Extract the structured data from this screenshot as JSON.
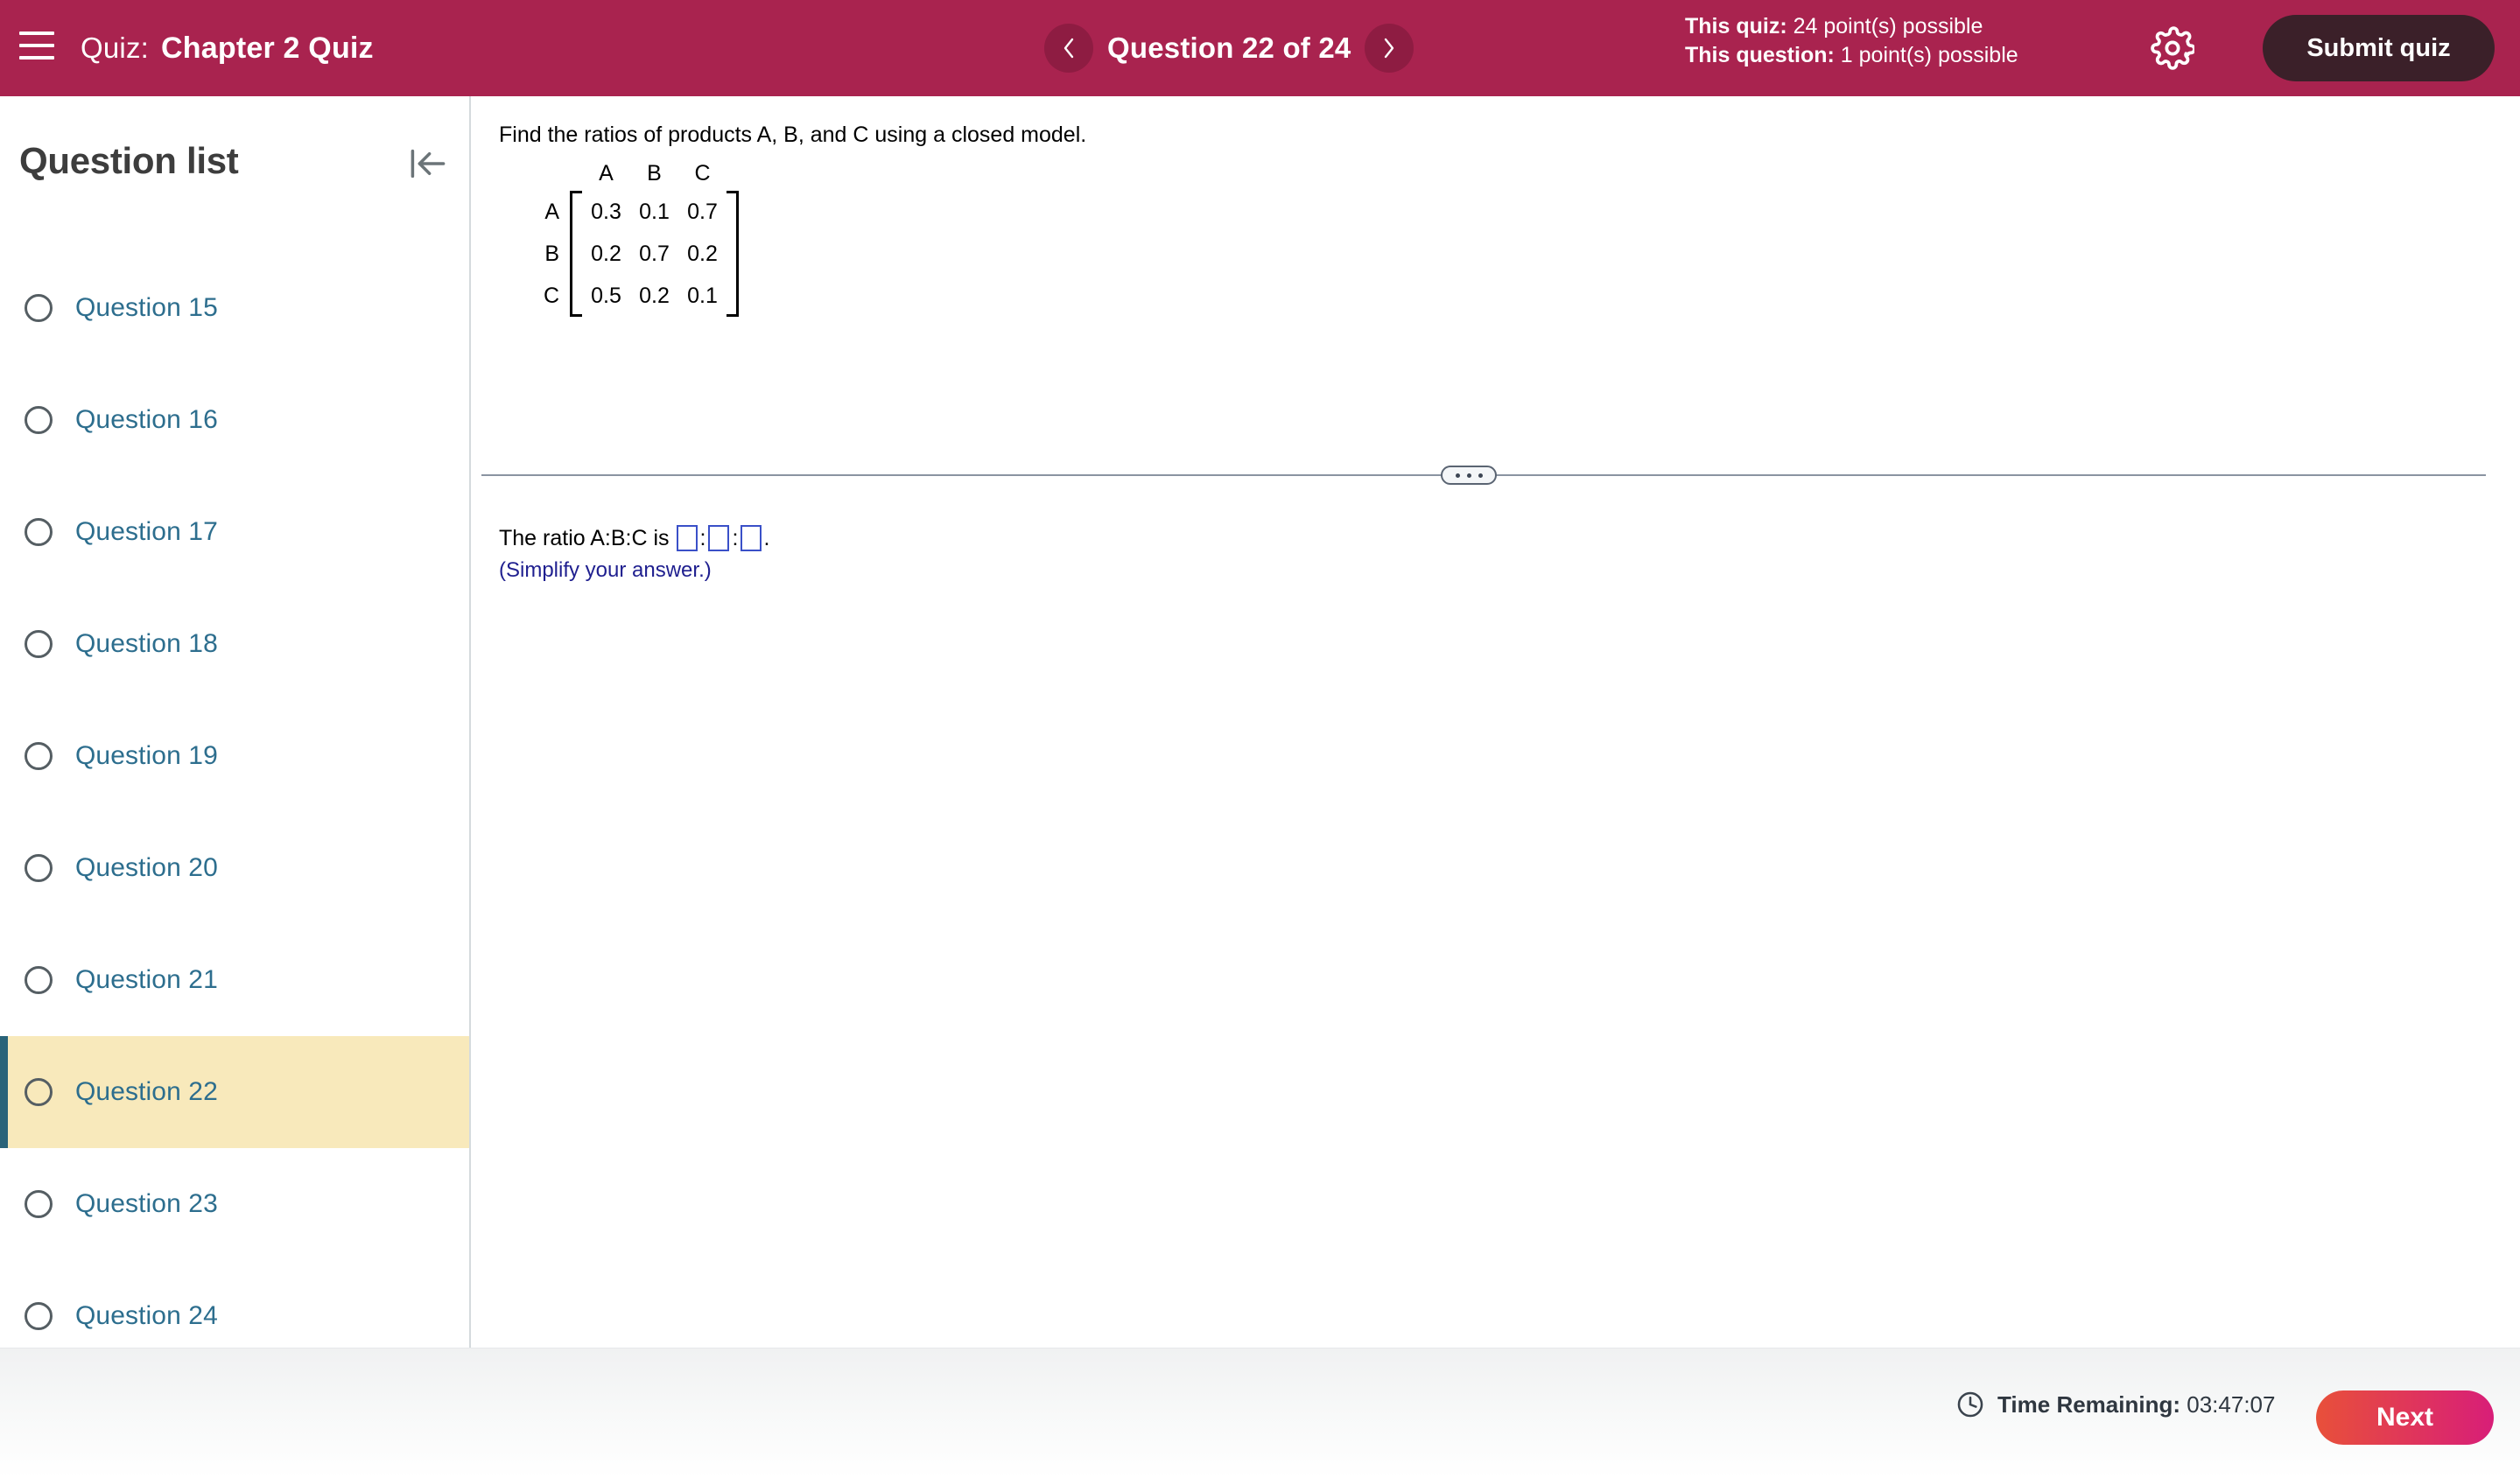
{
  "header": {
    "menu_icon": "hamburger-icon",
    "quiz_label": "Quiz:",
    "quiz_name": "Chapter 2 Quiz",
    "prev_icon": "chevron-left-icon",
    "next_icon": "chevron-right-icon",
    "question_counter": "Question 22 of 24",
    "points": {
      "quiz_label": "This quiz:",
      "quiz_value": "24 point(s) possible",
      "question_label": "This question:",
      "question_value": "1 point(s) possible"
    },
    "settings_icon": "gear-icon",
    "submit_label": "Submit quiz",
    "background_color": "#a9234f",
    "submit_color": "#3b2029"
  },
  "sidebar": {
    "title": "Question list",
    "collapse_icon": "collapse-left-icon",
    "active_index": 7,
    "items": [
      {
        "label": "Question 15"
      },
      {
        "label": "Question 16"
      },
      {
        "label": "Question 17"
      },
      {
        "label": "Question 18"
      },
      {
        "label": "Question 19"
      },
      {
        "label": "Question 20"
      },
      {
        "label": "Question 21"
      },
      {
        "label": "Question 22"
      },
      {
        "label": "Question 23"
      },
      {
        "label": "Question 24"
      }
    ],
    "active_bg_color": "#f8e9bb",
    "active_bar_color": "#2a6379",
    "link_color": "#2d6e8e"
  },
  "main": {
    "prompt": "Find the ratios of products A, B, and C using a closed model.",
    "matrix": {
      "col_headers": [
        "A",
        "B",
        "C"
      ],
      "row_labels": [
        "A",
        "B",
        "C"
      ],
      "rows": [
        [
          "0.3",
          "0.1",
          "0.7"
        ],
        [
          "0.2",
          "0.7",
          "0.2"
        ],
        [
          "0.5",
          "0.2",
          "0.1"
        ]
      ]
    },
    "splitter_icon": "ellipsis-handle-icon",
    "answer": {
      "text": "The ratio A:B:C is",
      "separator": ":",
      "period": ".",
      "boxes": [
        "",
        "",
        ""
      ],
      "hint": "(Simplify your answer.)",
      "box_border_color": "#3a50c8",
      "hint_color": "#1f1f8f"
    }
  },
  "footer": {
    "clock_icon": "clock-icon",
    "timer_label": "Time Remaining:",
    "timer_value": "03:47:07",
    "next_label": "Next",
    "next_gradient_start": "#e8503a",
    "next_gradient_end": "#d81e78"
  }
}
